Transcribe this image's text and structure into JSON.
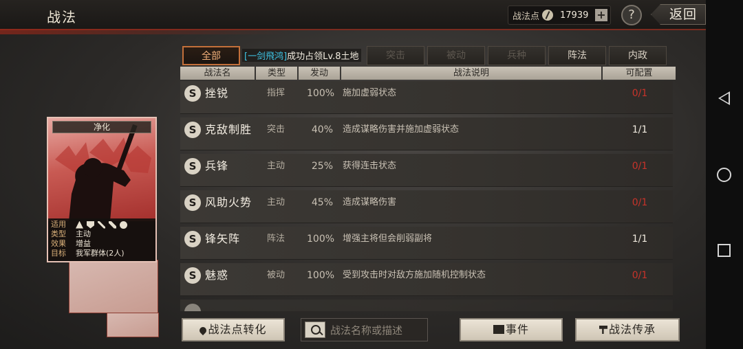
{
  "header": {
    "title": "战法",
    "points_label": "战法点",
    "points_value": "17939",
    "plus_label": "+",
    "help_label": "?",
    "back_label": "返回"
  },
  "tabs": [
    {
      "label": "全部"
    },
    {
      "label": "突击"
    },
    {
      "label": "被动"
    },
    {
      "label": "兵种"
    },
    {
      "label": "阵法"
    },
    {
      "label": "内政"
    }
  ],
  "notice": {
    "highlight": "[一剑飛鸿]",
    "text": "成功占领Lv.8土地"
  },
  "table_headers": [
    "战法名",
    "类型",
    "发动",
    "战法说明",
    "可配置"
  ],
  "skills": [
    {
      "badge": "S",
      "name": "挫锐",
      "type": "指挥",
      "rate": "100%",
      "desc": "施加虚弱状态",
      "config": "0/1",
      "config_color": "red"
    },
    {
      "badge": "S",
      "name": "克敌制胜",
      "type": "突击",
      "rate": "40%",
      "desc": "造成谋略伤害并施加虚弱状态",
      "config": "1/1",
      "config_color": "white"
    },
    {
      "badge": "S",
      "name": "兵锋",
      "type": "主动",
      "rate": "25%",
      "desc": "获得连击状态",
      "config": "0/1",
      "config_color": "red"
    },
    {
      "badge": "S",
      "name": "风助火势",
      "type": "主动",
      "rate": "45%",
      "desc": "造成谋略伤害",
      "config": "0/1",
      "config_color": "red"
    },
    {
      "badge": "S",
      "name": "锋矢阵",
      "type": "阵法",
      "rate": "100%",
      "desc": "增强主将但会削弱副将",
      "config": "1/1",
      "config_color": "white"
    },
    {
      "badge": "S",
      "name": "魅惑",
      "type": "被动",
      "rate": "100%",
      "desc": "受到攻击时对敌方施加随机控制状态",
      "config": "0/1",
      "config_color": "red"
    }
  ],
  "card": {
    "name": "净化",
    "applies_label": "适用",
    "type_label": "类型",
    "type_value": "主动",
    "effect_label": "效果",
    "effect_value": "增益",
    "target_label": "目标",
    "target_value": "我军群体(2人)"
  },
  "footer": {
    "convert_label": "战法点转化",
    "search_placeholder": "战法名称或描述",
    "event_label": "事件",
    "inherit_label": "战法传承"
  },
  "colors": {
    "accent_tab": "#c4703a",
    "notice_highlight": "#3fc6e6",
    "config_red": "#c8332a",
    "card_border": "#e6c2b6"
  }
}
